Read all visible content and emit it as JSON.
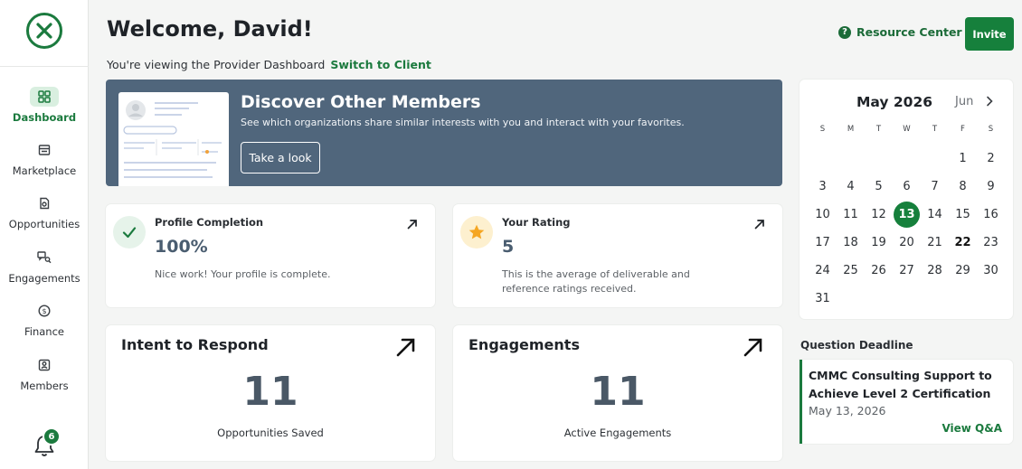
{
  "sidebar": {
    "items": [
      {
        "label": "Dashboard",
        "icon": "dashboard-icon"
      },
      {
        "label": "Marketplace",
        "icon": "marketplace-icon"
      },
      {
        "label": "Opportunities",
        "icon": "opportunities-icon"
      },
      {
        "label": "Engagements",
        "icon": "engagements-icon"
      },
      {
        "label": "Finance",
        "icon": "finance-icon"
      },
      {
        "label": "Members",
        "icon": "members-icon"
      }
    ],
    "active": "Dashboard",
    "notifications_count": "6"
  },
  "header": {
    "welcome": "Welcome, David!",
    "viewing_text": "You're viewing the Provider Dashboard",
    "switch_link": "Switch to Client",
    "resource_center": "Resource Center",
    "invite": "Invite"
  },
  "banner": {
    "title": "Discover Other Members",
    "subtitle": "See which organizations share similar interests with you and interact with your favorites.",
    "button": "Take a look"
  },
  "cards": {
    "profile": {
      "label": "Profile Completion",
      "value": "100%",
      "note": "Nice work! Your profile is complete."
    },
    "rating": {
      "label": "Your Rating",
      "value": "5",
      "note": "This is the average of deliverable and reference ratings received."
    },
    "intent": {
      "title": "Intent to Respond",
      "value": "11",
      "subtitle": "Opportunities Saved"
    },
    "engagements": {
      "title": "Engagements",
      "value": "11",
      "subtitle": "Active Engagements"
    }
  },
  "calendar": {
    "title": "May 2026",
    "next_month": "Jun",
    "weekdays": [
      "S",
      "M",
      "T",
      "W",
      "T",
      "F",
      "S"
    ],
    "days": [
      [
        "",
        "",
        "",
        "",
        "",
        "1",
        "2"
      ],
      [
        "3",
        "4",
        "5",
        "6",
        "7",
        "8",
        "9"
      ],
      [
        "10",
        "11",
        "12",
        "13",
        "14",
        "15",
        "16"
      ],
      [
        "17",
        "18",
        "19",
        "20",
        "21",
        "22",
        "23"
      ],
      [
        "24",
        "25",
        "26",
        "27",
        "28",
        "29",
        "30"
      ],
      [
        "31",
        "",
        "",
        "",
        "",
        "",
        ""
      ]
    ],
    "today": "13",
    "bold": "22"
  },
  "deadline": {
    "heading": "Question Deadline",
    "title": "CMMC Consulting Support to Achieve Level 2 Certification",
    "date": "May 13, 2026",
    "link": "View Q&A"
  },
  "colors": {
    "accent": "#16803c",
    "banner": "#50667c",
    "star": "#f5a623"
  }
}
